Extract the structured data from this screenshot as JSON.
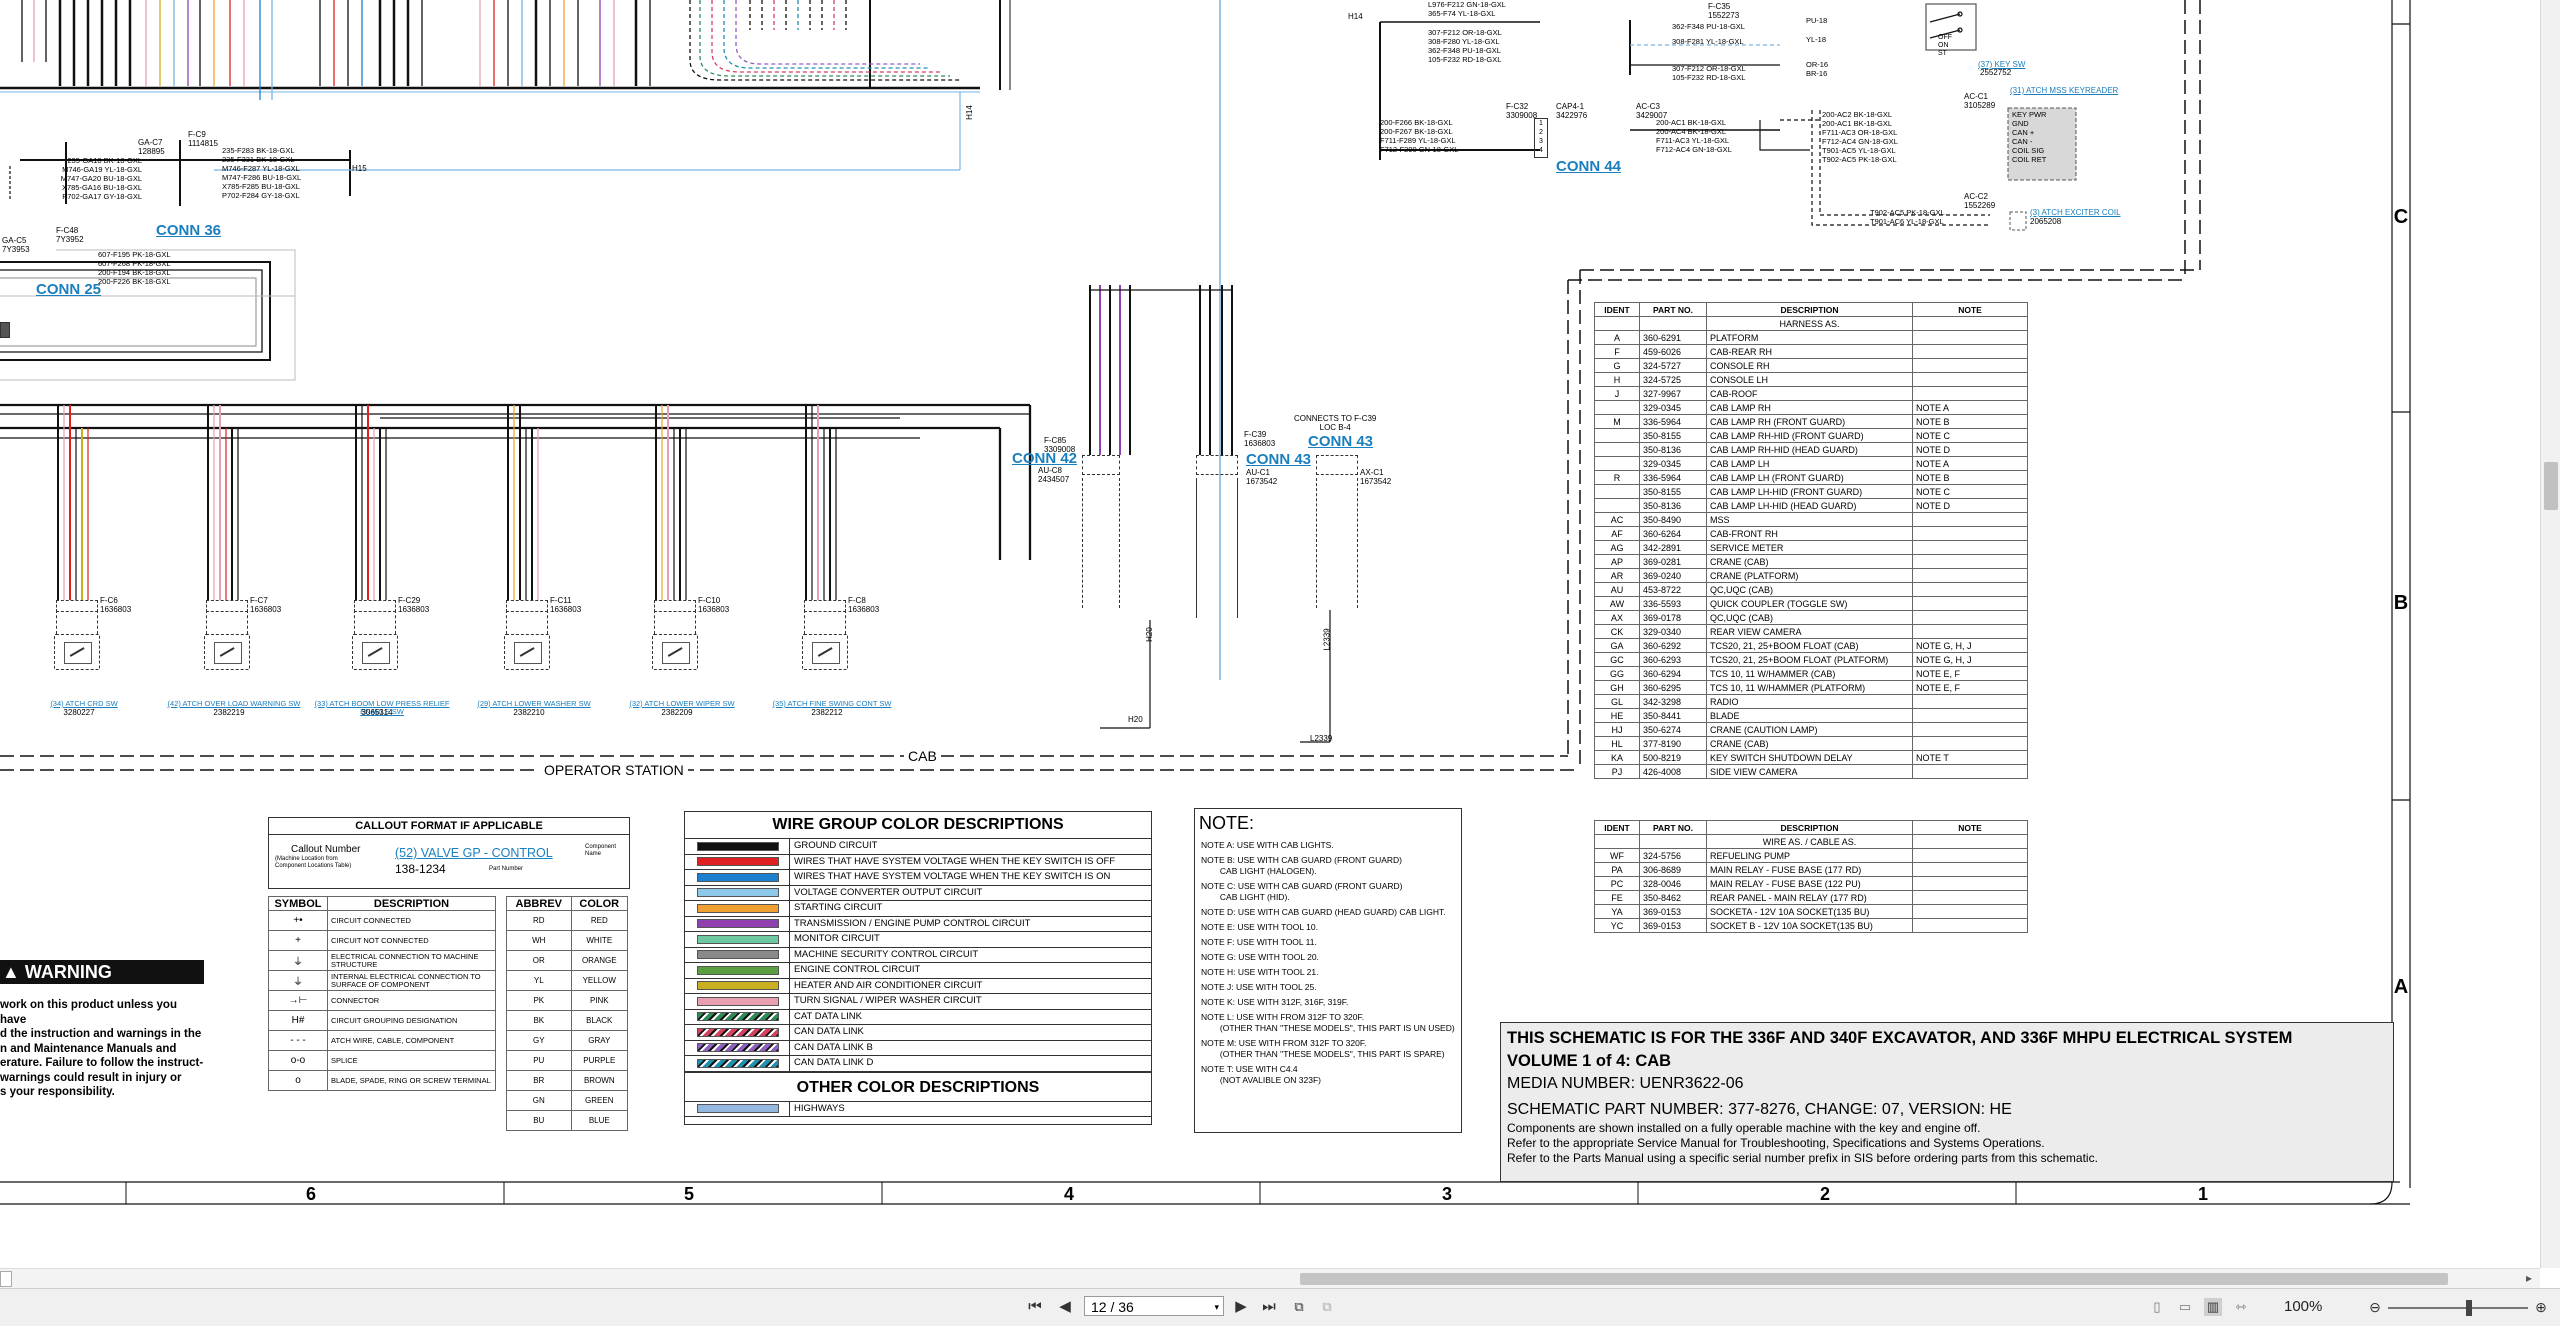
{
  "viewer": {
    "page_current": "12 / 36",
    "zoom": "100%",
    "zoom_fraction": 0.58,
    "hscroll_fraction": 0.51,
    "vscroll_fraction": 0.35
  },
  "schematic": {
    "grid_cols": [
      "6",
      "5",
      "4",
      "3",
      "2",
      "1"
    ],
    "grid_rows": [
      "C",
      "B",
      "A"
    ],
    "top_labels": {
      "h14": "H14",
      "h15": "H15",
      "h20": "H20",
      "l2339": "L2339",
      "f_c9": "F-C9",
      "f_c9_no": "1114815",
      "ga_c7": "GA-C7",
      "ga_c7_no": "128895",
      "f_c48": "F-C48",
      "f_c48_no": "7Y3952",
      "ga_c5": "GA-C5",
      "ga_c5_no": "7Y3953",
      "f_c32": "F-C32",
      "f_c32_no": "3309008",
      "cap4_1": "CAP4-1",
      "cap4_1_no": "3422976",
      "ac_c3": "AC-C3",
      "ac_c3_no": "3429007",
      "ac_c1": "AC-C1",
      "ac_c1_no": "3105289",
      "ac_c2": "AC-C2",
      "ac_c2_no": "1552269",
      "f_c35": "F-C35",
      "f_c35_no": "1552273",
      "f_c35b": "F-C35",
      "f_c35b_no": "3309008",
      "au_c8": "AU-C8",
      "au_c8_no": "2434507",
      "f_c39": "F-C39",
      "f_c39_no": "1636803",
      "au_c1": "AU-C1",
      "au_c1_no": "1673542",
      "ax_c1": "AX-C1",
      "ax_c1_no": "1673542",
      "connects": "CONNECTS TO F-C39",
      "connects2": "LOC B-4",
      "cab": "CAB",
      "operator": "OPERATOR STATION"
    },
    "conns": {
      "c36": "CONN 36",
      "c25": "CONN 25",
      "c44": "CONN 44",
      "c42": "CONN 42",
      "c43a": "CONN 43",
      "c43b": "CONN 43"
    },
    "wires_top_left": [
      "235-GA18 BK-18-GXL",
      "M746-GA19 YL-18-GXL",
      "M747-GA20 BU-18-GXL",
      "X785-GA16 BU-18-GXL",
      "P702-GA17 GY-18-GXL"
    ],
    "wires_fc9": [
      "235-F283 BK-18-GXL",
      "235-F331 BK-18-GXL",
      "M746-F287 YL-18-GXL",
      "M747-F286 BU-18-GXL",
      "X785-F285 BU-18-GXL",
      "P702-F284 GY-18-GXL"
    ],
    "wires_fc48": [
      "607-F195 PK-18-GXL",
      "607-F268 PK-18-GXL",
      "200-F194 BK-18-GXL",
      "200-F226 BK-18-GXL"
    ],
    "wires_top_right1": [
      "L976-F212 GN-18-GXL",
      "365-F74 YL-18-GXL"
    ],
    "wires_fc32": [
      "307-F212 OR-18-GXL",
      "308-F280 YL-18-GXL",
      "362-F348 PU-18-GXL",
      "105-F232 RD-18-GXL"
    ],
    "wires_fc35": [
      "362-F348 PU-18-GXL",
      "308-F281 YL-18-GXL",
      "307-F212 OR-18-GXL",
      "105-F232 RD-18-GXL"
    ],
    "wires_fc35_right": [
      "PU-18",
      "YL-18",
      "OR-16",
      "BR-16"
    ],
    "wires_cap": [
      "200-F266 BK-18-GXL",
      "200-F267 BK-18-GXL",
      "F711-F289 YL-18-GXL",
      "F712-F290 GN-18-GXL"
    ],
    "wires_ac3": [
      "200-AC1 BK-18-GXL",
      "200-AC4 BK-18-GXL",
      "F711-AC3 YL-18-GXL",
      "F712-AC4 GN-18-GXL"
    ],
    "wires_ac1": [
      "200-AC2 BK-18-GXL",
      "200-AC1 BK-18-GXL",
      "F711-AC3 OR-18-GXL",
      "F712-AC4 GN-18-GXL",
      "T901-AC5 YL-18-GXL",
      "T902-AC5 PK-18-GXL"
    ],
    "ac1_pins": [
      "KEY PWR",
      "GND",
      "CAN +",
      "CAN -",
      "COIL SIG",
      "COIL RET"
    ],
    "wires_ac2": [
      "T902-AC5 PK-18-GXL",
      "T901-AC6 YL-18-GXL"
    ],
    "sw_key": "(37) KEY SW",
    "sw_key_no": "2552752",
    "sw_mss": "(31) ATCH MSS KEYREADER",
    "sw_exciter": "(3) ATCH EXCITER COIL",
    "sw_exciter_no": "2065208",
    "sw_labels": [
      "OFF",
      "ON",
      "ST"
    ],
    "switches": [
      {
        "link": "(34) ATCH CRD SW",
        "pn": "3280227",
        "conn": "F-C6",
        "conn_no": "1636803"
      },
      {
        "link": "(42) ATCH OVER LOAD WARNING SW",
        "pn": "2382219",
        "conn": "F-C7",
        "conn_no": "1636803"
      },
      {
        "link": "(33) ATCH BOOM LOW PRESS RELIEF ENABLE SW",
        "pn": "3065314",
        "conn": "F-C29",
        "conn_no": "1636803"
      },
      {
        "link": "(29) ATCH LOWER WASHER SW",
        "pn": "2382210",
        "conn": "F-C11",
        "conn_no": "1636803"
      },
      {
        "link": "(32) ATCH LOWER WIPER SW",
        "pn": "2382209",
        "conn": "F-C10",
        "conn_no": "1636803"
      },
      {
        "link": "(35) ATCH FINE SWING CONT SW",
        "pn": "2382212",
        "conn": "F-C8",
        "conn_no": "1636803"
      }
    ],
    "callout": {
      "title": "CALLOUT FORMAT IF APPLICABLE",
      "callout_number": "Callout Number",
      "machine_location": "(Machine Location from",
      "component_locations": "Component Locations Table)",
      "example": "(52) VALVE GP - CONTROL",
      "part_example": "138-1234",
      "component_name": "Component",
      "component_name2": "Name",
      "part_number": "Part Number"
    },
    "symbol_table": {
      "headers": [
        "SYMBOL",
        "DESCRIPTION"
      ],
      "rows": [
        {
          "sym": "+•",
          "desc": "CIRCUIT CONNECTED"
        },
        {
          "sym": "+",
          "desc": "CIRCUIT NOT CONNECTED"
        },
        {
          "sym": "⏚",
          "desc": "ELECTRICAL CONNECTION TO MACHINE STRUCTURE"
        },
        {
          "sym": "⏚",
          "desc": "INTERNAL ELECTRICAL CONNECTION TO SURFACE OF COMPONENT"
        },
        {
          "sym": "→⊢",
          "desc": "CONNECTOR"
        },
        {
          "sym": "H#",
          "desc": "CIRCUIT GROUPING DESIGNATION"
        },
        {
          "sym": "- - -",
          "desc": "ATCH WIRE, CABLE, COMPONENT"
        },
        {
          "sym": "o-o",
          "desc": "SPLICE"
        },
        {
          "sym": "o",
          "desc": "BLADE, SPADE, RING OR SCREW TERMINAL"
        }
      ]
    },
    "abbrev_table": {
      "headers": [
        "ABBREV",
        "COLOR"
      ],
      "rows": [
        [
          "RD",
          "RED"
        ],
        [
          "WH",
          "WHITE"
        ],
        [
          "OR",
          "ORANGE"
        ],
        [
          "YL",
          "YELLOW"
        ],
        [
          "PK",
          "PINK"
        ],
        [
          "BK",
          "BLACK"
        ],
        [
          "GY",
          "GRAY"
        ],
        [
          "PU",
          "PURPLE"
        ],
        [
          "BR",
          "BROWN"
        ],
        [
          "GN",
          "GREEN"
        ],
        [
          "BU",
          "BLUE"
        ]
      ]
    },
    "warning": {
      "title": "WARNING",
      "lines": [
        "work on this product unless you have",
        "d the instruction and warnings in the",
        "n and Maintenance Manuals and",
        "erature. Failure to follow the instruct-",
        "warnings could result in injury or",
        "s your responsibility."
      ]
    },
    "wire_groups": {
      "title": "WIRE GROUP COLOR DESCRIPTIONS",
      "rows": [
        {
          "color": "#111111",
          "pattern": "solid",
          "label": "GROUND CIRCUIT"
        },
        {
          "color": "#e02020",
          "pattern": "solid",
          "label": "WIRES THAT HAVE SYSTEM VOLTAGE WHEN THE KEY SWITCH IS OFF"
        },
        {
          "color": "#1c7fd0",
          "pattern": "solid",
          "label": "WIRES THAT HAVE SYSTEM VOLTAGE WHEN THE KEY SWITCH IS ON"
        },
        {
          "color": "#8ec8ea",
          "pattern": "solid",
          "label": "VOLTAGE CONVERTER OUTPUT CIRCUIT"
        },
        {
          "color": "#f0a030",
          "pattern": "solid",
          "label": "STARTING CIRCUIT"
        },
        {
          "color": "#9040b0",
          "pattern": "solid",
          "label": "TRANSMISSION / ENGINE PUMP CONTROL CIRCUIT"
        },
        {
          "color": "#6cc9a0",
          "pattern": "solid",
          "label": "MONITOR CIRCUIT"
        },
        {
          "color": "#8a8a8a",
          "pattern": "solid",
          "label": "MACHINE SECURITY CONTROL CIRCUIT"
        },
        {
          "color": "#5aa040",
          "pattern": "solid",
          "label": "ENGINE CONTROL CIRCUIT"
        },
        {
          "color": "#c8b020",
          "pattern": "solid",
          "label": "HEATER AND AIR CONDITIONER CIRCUIT"
        },
        {
          "color": "#e8a0b0",
          "pattern": "solid",
          "label": "TURN SIGNAL / WIPER WASHER CIRCUIT"
        },
        {
          "color": "#2e8b57",
          "pattern": "hatch",
          "label": "CAT DATA LINK"
        },
        {
          "color": "#d44060",
          "pattern": "hatch",
          "label": "CAN DATA LINK"
        },
        {
          "color": "#9060c0",
          "pattern": "hatch",
          "label": "CAN DATA LINK B"
        },
        {
          "color": "#2090b0",
          "pattern": "hatch",
          "label": "CAN DATA LINK D"
        }
      ],
      "other_title": "OTHER COLOR DESCRIPTIONS",
      "other_rows": [
        {
          "color": "#95b8e0",
          "pattern": "solid",
          "label": "HIGHWAYS"
        }
      ]
    },
    "notes": {
      "title": "NOTE:",
      "lines": [
        "NOTE A: USE WITH CAB LIGHTS.",
        "",
        "NOTE B: USE WITH CAB GUARD (FRONT GUARD)",
        "        CAB LIGHT (HALOGEN).",
        "",
        "NOTE C: USE WITH CAB GUARD (FRONT GUARD)",
        "        CAB LIGHT (HID).",
        "",
        "NOTE D: USE WITH CAB GUARD (HEAD GUARD) CAB LIGHT.",
        "",
        "NOTE E: USE WITH TOOL 10.",
        "",
        "NOTE F: USE WITH TOOL 11.",
        "",
        "NOTE G: USE WITH TOOL 20.",
        "",
        "NOTE H: USE WITH TOOL 21.",
        "",
        "NOTE J: USE WITH TOOL 25.",
        "",
        "NOTE K: USE WITH 312F, 316F, 319F.",
        "",
        "NOTE L: USE WITH FROM 312F TO 320F.",
        "        (OTHER THAN \"THESE MODELS\", THIS PART IS UN USED)",
        "",
        "NOTE M: USE WITH FROM 312F TO 320F.",
        "        (OTHER THAN \"THESE MODELS\", THIS PART IS SPARE)",
        "",
        "NOTE T: USE WITH C4.4",
        "        (NOT AVALIBLE ON 323F)"
      ]
    },
    "harness_table": {
      "headers": [
        "IDENT",
        "PART NO.",
        "DESCRIPTION",
        "NOTE"
      ],
      "section": "HARNESS AS.",
      "rows": [
        [
          "A",
          "360-6291",
          "PLATFORM",
          ""
        ],
        [
          "F",
          "459-6026",
          "CAB-REAR RH",
          ""
        ],
        [
          "G",
          "324-5727",
          "CONSOLE RH",
          ""
        ],
        [
          "H",
          "324-5725",
          "CONSOLE LH",
          ""
        ],
        [
          "J",
          "327-9967",
          "CAB-ROOF",
          ""
        ],
        [
          "",
          "329-0345",
          "CAB LAMP RH",
          "NOTE A"
        ],
        [
          "M",
          "336-5964",
          "CAB LAMP RH (FRONT GUARD)",
          "NOTE B"
        ],
        [
          "",
          "350-8155",
          "CAB LAMP RH-HID (FRONT GUARD)",
          "NOTE C"
        ],
        [
          "",
          "350-8136",
          "CAB LAMP RH-HID (HEAD GUARD)",
          "NOTE D"
        ],
        [
          "",
          "329-0345",
          "CAB LAMP LH",
          "NOTE A"
        ],
        [
          "R",
          "336-5964",
          "CAB LAMP LH (FRONT GUARD)",
          "NOTE B"
        ],
        [
          "",
          "350-8155",
          "CAB LAMP LH-HID (FRONT GUARD)",
          "NOTE C"
        ],
        [
          "",
          "350-8136",
          "CAB LAMP LH-HID (HEAD GUARD)",
          "NOTE D"
        ],
        [
          "AC",
          "350-8490",
          "MSS",
          ""
        ],
        [
          "AF",
          "360-6264",
          "CAB-FRONT RH",
          ""
        ],
        [
          "AG",
          "342-2891",
          "SERVICE METER",
          ""
        ],
        [
          "AP",
          "369-0281",
          "CRANE (CAB)",
          ""
        ],
        [
          "AR",
          "369-0240",
          "CRANE (PLATFORM)",
          ""
        ],
        [
          "AU",
          "453-8722",
          "QC,UQC (CAB)",
          ""
        ],
        [
          "AW",
          "336-5593",
          "QUICK COUPLER (TOGGLE SW)",
          ""
        ],
        [
          "AX",
          "369-0178",
          "QC,UQC (CAB)",
          ""
        ],
        [
          "CK",
          "329-0340",
          "REAR VIEW CAMERA",
          ""
        ],
        [
          "GA",
          "360-6292",
          "TCS20, 21, 25+BOOM FLOAT (CAB)",
          "NOTE G, H, J"
        ],
        [
          "GC",
          "360-6293",
          "TCS20, 21, 25+BOOM FLOAT (PLATFORM)",
          "NOTE G, H, J"
        ],
        [
          "GG",
          "360-6294",
          "TCS 10, 11 W/HAMMER (CAB)",
          "NOTE E, F"
        ],
        [
          "GH",
          "360-6295",
          "TCS 10, 11 W/HAMMER (PLATFORM)",
          "NOTE E, F"
        ],
        [
          "GL",
          "342-3298",
          "RADIO",
          ""
        ],
        [
          "HE",
          "350-8441",
          "BLADE",
          ""
        ],
        [
          "HJ",
          "350-6274",
          "CRANE (CAUTION LAMP)",
          ""
        ],
        [
          "HL",
          "377-8190",
          "CRANE (CAB)",
          ""
        ],
        [
          "KA",
          "500-8219",
          "KEY SWITCH SHUTDOWN DELAY",
          "NOTE T"
        ],
        [
          "PJ",
          "426-4008",
          "SIDE VIEW CAMERA",
          ""
        ]
      ]
    },
    "wire_table": {
      "headers": [
        "IDENT",
        "PART NO.",
        "DESCRIPTION",
        "NOTE"
      ],
      "section": "WIRE AS. / CABLE AS.",
      "rows": [
        [
          "WF",
          "324-5756",
          "REFUELING PUMP",
          ""
        ],
        [
          "PA",
          "306-8689",
          "MAIN RELAY - FUSE BASE (177 RD)",
          ""
        ],
        [
          "PC",
          "328-0046",
          "MAIN RELAY - FUSE BASE (122 PU)",
          ""
        ],
        [
          "FE",
          "350-8462",
          "REAR PANEL - MAIN RELAY (177 RD)",
          ""
        ],
        [
          "YA",
          "369-0153",
          "SOCKETA - 12V 10A SOCKET(135 BU)",
          ""
        ],
        [
          "YC",
          "369-0153",
          "SOCKET B - 12V 10A SOCKET(135 BU)",
          ""
        ]
      ]
    },
    "title_block": {
      "heading": "THIS SCHEMATIC IS FOR THE 336F AND 340F EXCAVATOR, AND 336F MHPU ELECTRICAL SYSTEM",
      "volume": "VOLUME 1 of 4: CAB",
      "media": "MEDIA NUMBER: UENR3622-06",
      "part": "SCHEMATIC PART NUMBER: 377-8276, CHANGE: 07, VERSION: HE",
      "line1": "Components are shown installed on a fully operable machine with the key and engine off.",
      "line2": "Refer to the appropriate Service Manual for Troubleshooting, Specifications and Systems Operations.",
      "line3": "Refer to the Parts Manual using a specific serial number prefix in SIS before ordering parts from this schematic."
    }
  },
  "colors": {
    "link": "#1a7fbf",
    "title_bg": "#ececec"
  }
}
